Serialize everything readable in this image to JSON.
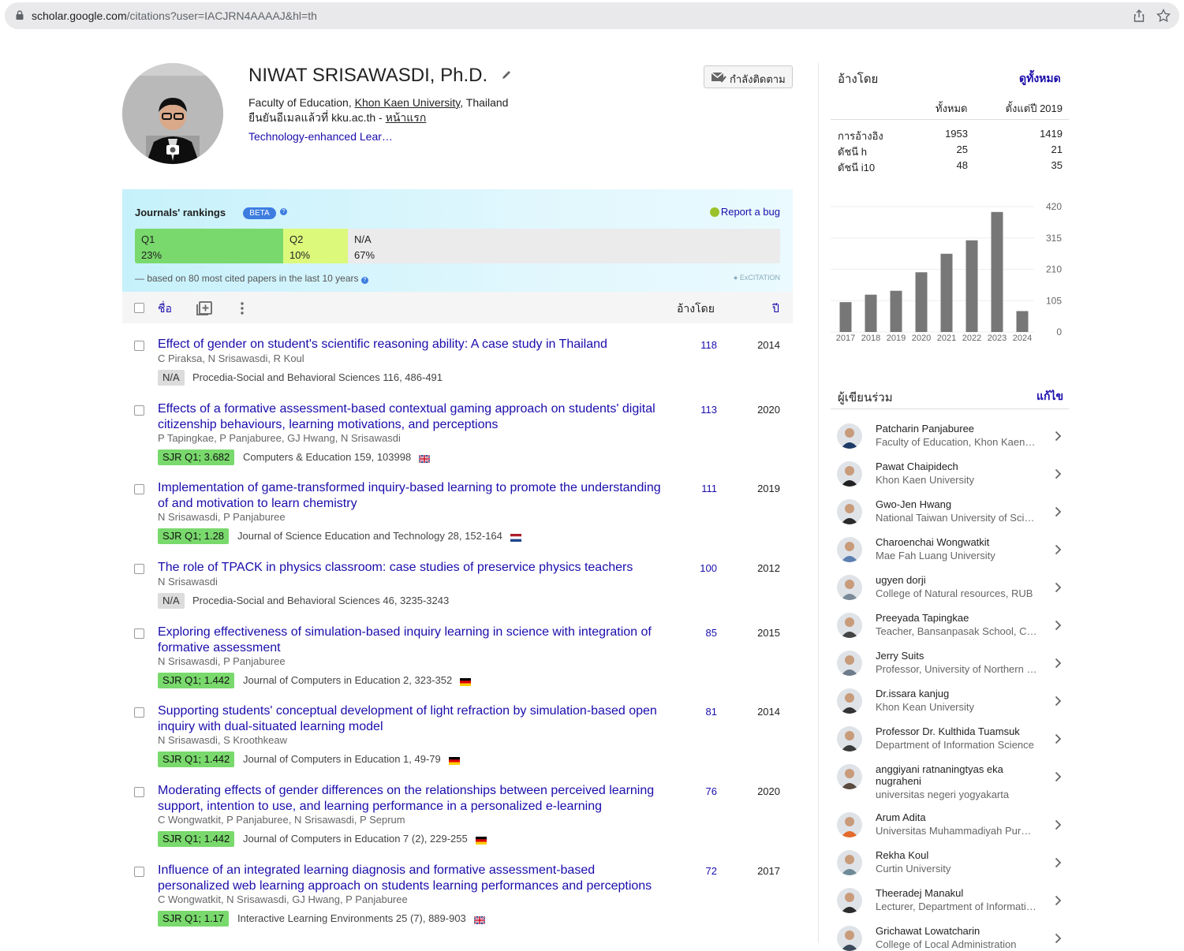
{
  "browser": {
    "url_host": "scholar.google.com",
    "url_path": "/citations?user=IACJRN4AAAAJ&hl=th"
  },
  "profile": {
    "name": "NIWAT SRISAWASDI, Ph.D.",
    "affil_prefix": "Faculty of Education, ",
    "affil_univ": "Khon Kaen University",
    "affil_suffix": ", Thailand",
    "email_text": "ยืนยันอีเมลแล้วที่ kku.ac.th - ",
    "homepage": "หน้าแรก",
    "interest": "Technology-enhanced Lear…",
    "follow_label": "กำลังติดตาม"
  },
  "rankings": {
    "title": "Journals' rankings",
    "beta": "BETA",
    "report_bug": "Report a bug",
    "segments": [
      {
        "label": "Q1",
        "pct": "23%",
        "share": 23,
        "color": "#79d96c"
      },
      {
        "label": "Q2",
        "pct": "10%",
        "share": 10,
        "color": "#dcf97c"
      },
      {
        "label": "N/A",
        "pct": "67%",
        "share": 67,
        "color": "#ebebeb"
      }
    ],
    "note": "— based on 80 most cited papers in the last 10 years",
    "brand": "ExCITATION"
  },
  "table": {
    "col_title": "ชื่อ",
    "col_cited": "อ้างโดย",
    "col_year": "ปี"
  },
  "papers": [
    {
      "title": "Effect of gender on student's scientific reasoning ability: A case study in Thailand",
      "authors": "C Piraksa, N Srisawasdi, R Koul",
      "badge": "N/A",
      "venue": "Procedia-Social and Behavioral Sciences 116, 486-491",
      "cited": "118",
      "year": "2014",
      "flag": ""
    },
    {
      "title": "Effects of a formative assessment-based contextual gaming approach on students' digital citizenship behaviours, learning motivations, and perceptions",
      "authors": "P Tapingkae, P Panjaburee, GJ Hwang, N Srisawasdi",
      "badge": "SJR Q1; 3.682",
      "venue": "Computers & Education 159, 103998",
      "cited": "113",
      "year": "2020",
      "flag": "uk"
    },
    {
      "title": "Implementation of game-transformed inquiry-based learning to promote the understanding of and motivation to learn chemistry",
      "authors": "N Srisawasdi, P Panjaburee",
      "badge": "SJR Q1; 1.28",
      "venue": "Journal of Science Education and Technology 28, 152-164",
      "cited": "111",
      "year": "2019",
      "flag": "nl"
    },
    {
      "title": "The role of TPACK in physics classroom: case studies of preservice physics teachers",
      "authors": "N Srisawasdi",
      "badge": "N/A",
      "venue": "Procedia-Social and Behavioral Sciences 46, 3235-3243",
      "cited": "100",
      "year": "2012",
      "flag": ""
    },
    {
      "title": "Exploring effectiveness of simulation-based inquiry learning in science with integration of formative assessment",
      "authors": "N Srisawasdi, P Panjaburee",
      "badge": "SJR Q1; 1.442",
      "venue": "Journal of Computers in Education 2, 323-352",
      "cited": "85",
      "year": "2015",
      "flag": "de"
    },
    {
      "title": "Supporting students' conceptual development of light refraction by simulation-based open inquiry with dual-situated learning model",
      "authors": "N Srisawasdi, S Kroothkeaw",
      "badge": "SJR Q1; 1.442",
      "venue": "Journal of Computers in Education 1, 49-79",
      "cited": "81",
      "year": "2014",
      "flag": "de"
    },
    {
      "title": "Moderating effects of gender differences on the relationships between perceived learning support, intention to use, and learning performance in a personalized e-learning",
      "authors": "C Wongwatkit, P Panjaburee, N Srisawasdi, P Seprum",
      "badge": "SJR Q1; 1.442",
      "venue": "Journal of Computers in Education 7 (2), 229-255",
      "cited": "76",
      "year": "2020",
      "flag": "de"
    },
    {
      "title": "Influence of an integrated learning diagnosis and formative assessment-based personalized web learning approach on students learning performances and perceptions",
      "authors": "C Wongwatkit, N Srisawasdi, GJ Hwang, P Panjaburee",
      "badge": "SJR Q1; 1.17",
      "venue": "Interactive Learning Environments 25 (7), 889-903",
      "cited": "72",
      "year": "2017",
      "flag": "uk"
    }
  ],
  "cited_by": {
    "heading": "อ้างโดย",
    "view_all": "ดูทั้งหมด",
    "col_all": "ทั้งหมด",
    "col_since": "ตั้งแต่ปี 2019",
    "rows": [
      {
        "label": "การอ้างอิง",
        "all": "1953",
        "since": "1419"
      },
      {
        "label": "ดัชนี h",
        "all": "25",
        "since": "21"
      },
      {
        "label": "ดัชนี i10",
        "all": "48",
        "since": "35"
      }
    ]
  },
  "chart_data": {
    "type": "bar",
    "categories": [
      "2017",
      "2018",
      "2019",
      "2020",
      "2021",
      "2022",
      "2023",
      "2024"
    ],
    "values": [
      100,
      125,
      138,
      200,
      262,
      307,
      402,
      70
    ],
    "yticks": [
      "0",
      "105",
      "210",
      "315",
      "420"
    ],
    "ylim": [
      0,
      420
    ],
    "color": "#777777",
    "grid": true
  },
  "coauthors": {
    "heading": "ผู้เขียนร่วม",
    "edit": "แก้ไข",
    "items": [
      {
        "name": "Patcharin Panjaburee",
        "affil": "Faculty of Education, Khon Kaen University"
      },
      {
        "name": "Pawat Chaipidech",
        "affil": "Khon Kaen University"
      },
      {
        "name": "Gwo-Jen Hwang",
        "affil": "National Taiwan University of Science and Technology"
      },
      {
        "name": "Charoenchai Wongwatkit",
        "affil": "Mae Fah Luang University"
      },
      {
        "name": "ugyen dorji",
        "affil": "College of Natural resources, RUB"
      },
      {
        "name": "Preeyada Tapingkae",
        "affil": "Teacher, Bansanpasak School, Chiang Mai"
      },
      {
        "name": "Jerry Suits",
        "affil": "Professor, University of Northern Colorado"
      },
      {
        "name": "Dr.issara kanjug",
        "affil": "Khon Kean University"
      },
      {
        "name": "Professor Dr. Kulthida Tuamsuk",
        "affil": "Department of Information Science"
      },
      {
        "name": "anggiyani ratnaningtyas eka nugraheni",
        "affil": "universitas negeri yogyakarta"
      },
      {
        "name": "Arum Adita",
        "affil": "Universitas Muhammadiyah Purwokerto"
      },
      {
        "name": "Rekha Koul",
        "affil": "Curtin University"
      },
      {
        "name": "Theeradej Manakul",
        "affil": "Lecturer, Department of Information Technology"
      },
      {
        "name": "Grichawat Lowatcharin",
        "affil": "College of Local Administration"
      }
    ]
  }
}
